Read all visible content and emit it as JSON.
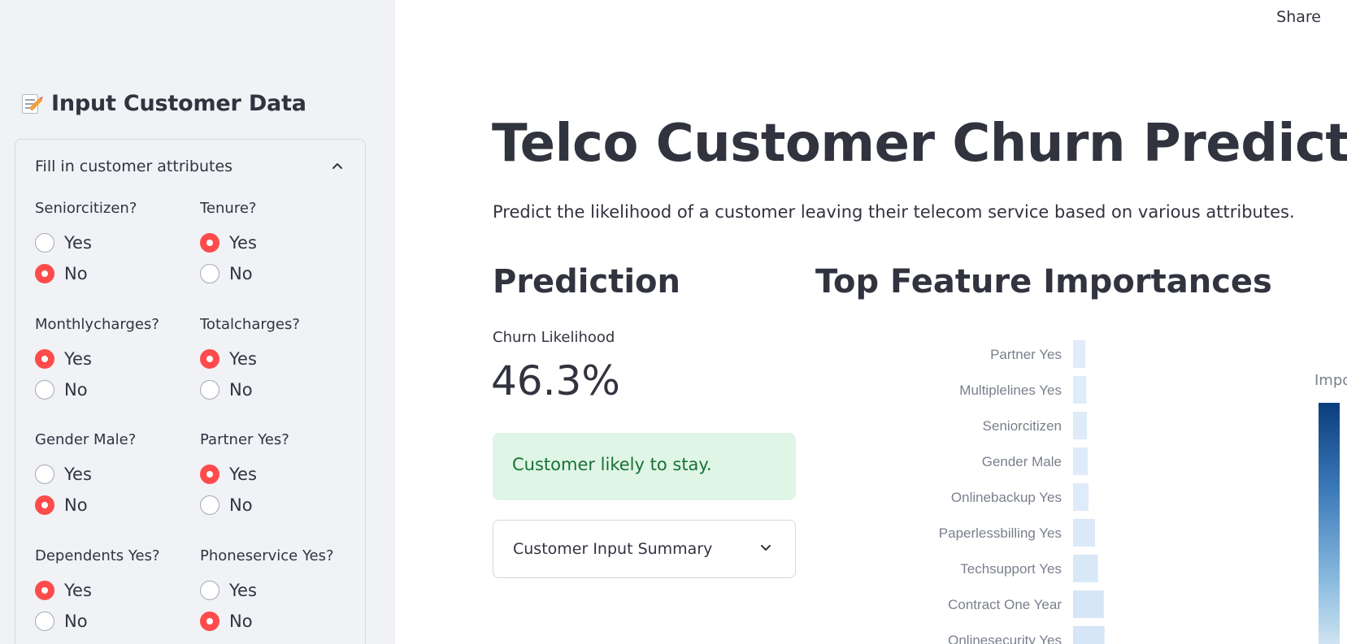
{
  "sidebar": {
    "title": "Input Customer Data",
    "expander_label": "Fill in customer attributes",
    "fields": [
      {
        "label": "Seniorcitizen?",
        "options": [
          "Yes",
          "No"
        ],
        "selected": "No"
      },
      {
        "label": "Tenure?",
        "options": [
          "Yes",
          "No"
        ],
        "selected": "Yes"
      },
      {
        "label": "Monthlycharges?",
        "options": [
          "Yes",
          "No"
        ],
        "selected": "Yes"
      },
      {
        "label": "Totalcharges?",
        "options": [
          "Yes",
          "No"
        ],
        "selected": "Yes"
      },
      {
        "label": "Gender Male?",
        "options": [
          "Yes",
          "No"
        ],
        "selected": "No"
      },
      {
        "label": "Partner Yes?",
        "options": [
          "Yes",
          "No"
        ],
        "selected": "Yes"
      },
      {
        "label": "Dependents Yes?",
        "options": [
          "Yes",
          "No"
        ],
        "selected": "Yes"
      },
      {
        "label": "Phoneservice Yes?",
        "options": [
          "Yes",
          "No"
        ],
        "selected": "No"
      }
    ]
  },
  "header": {
    "share_label": "Share"
  },
  "main": {
    "title": "Telco Customer Churn Predictor",
    "subtitle": "Predict the likelihood of a customer leaving their telecom service based on various attributes.",
    "prediction_heading": "Prediction",
    "metric_label": "Churn Likelihood",
    "metric_value": "46.3%",
    "alert_text": "Customer likely to stay.",
    "summary_label": "Customer Input Summary",
    "importance_heading": "Top Feature Importances"
  },
  "chart_data": {
    "type": "bar",
    "orientation": "horizontal",
    "categories": [
      "Partner Yes",
      "Multiplelines Yes",
      "Seniorcitizen",
      "Gender Male",
      "Onlinebackup Yes",
      "Paperlessbilling Yes",
      "Techsupport Yes",
      "Contract One Year",
      "Onlinesecurity Yes"
    ],
    "values": [
      0.017,
      0.018,
      0.019,
      0.02,
      0.021,
      0.03,
      0.034,
      0.042,
      0.043
    ],
    "colorbar_title": "Impo",
    "colors": {
      "low": "#e6f0fb",
      "high": "#0b3d7e"
    }
  }
}
